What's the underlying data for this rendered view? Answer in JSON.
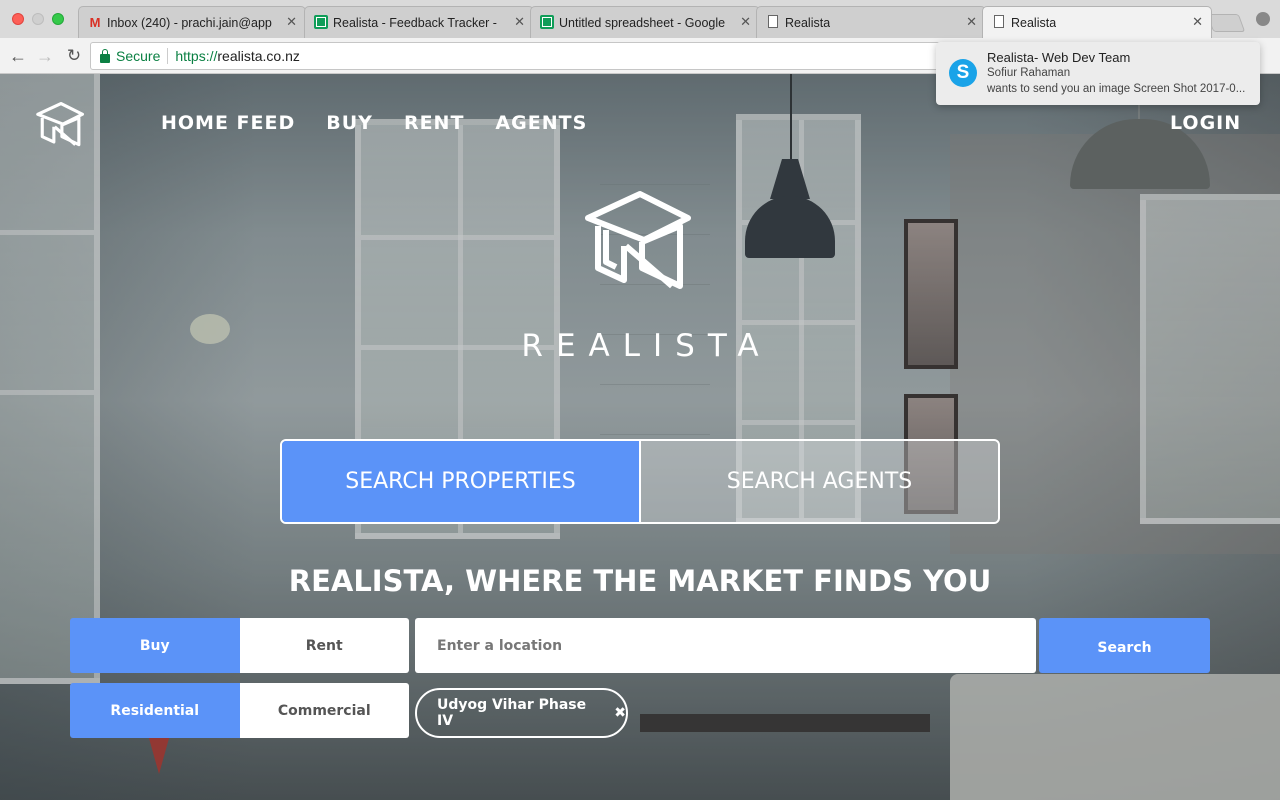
{
  "browser": {
    "tabs": [
      {
        "title": "Inbox (240) - prachi.jain@app",
        "icon": "gmail-icon",
        "active": false
      },
      {
        "title": "Realista - Feedback Tracker -",
        "icon": "sheets-icon",
        "active": false
      },
      {
        "title": "Untitled spreadsheet - Google",
        "icon": "sheets-icon",
        "active": false
      },
      {
        "title": "Realista",
        "icon": "document-icon",
        "active": false
      },
      {
        "title": "Realista",
        "icon": "document-icon",
        "active": true
      }
    ],
    "close_glyph": "✕",
    "secure_label": "Secure",
    "url_scheme": "https://",
    "url_host": "realista.co.nz"
  },
  "notification": {
    "app_icon": "skype-icon",
    "title": "Realista- Web Dev Team",
    "sender": "Sofiur Rahaman",
    "message": "wants to send you an image Screen Shot 2017-0..."
  },
  "site": {
    "nav": {
      "home_feed": "HOME FEED",
      "buy": "BUY",
      "rent": "RENT",
      "agents": "AGENTS",
      "login": "LOGIN"
    },
    "brand": "REALISTA",
    "search_tabs": {
      "properties": "SEARCH PROPERTIES",
      "agents": "SEARCH AGENTS",
      "active": "properties"
    },
    "tagline": "REALISTA, WHERE THE MARKET FINDS YOU",
    "listing_type": {
      "buy": "Buy",
      "rent": "Rent",
      "selected": "Buy"
    },
    "property_type": {
      "residential": "Residential",
      "commercial": "Commercial",
      "selected": "Residential"
    },
    "location_input": {
      "placeholder": "Enter a location",
      "value": ""
    },
    "search_button": "Search",
    "location_chip": {
      "label": "Udyog Vihar Phase IV",
      "remove_glyph": "✖"
    },
    "accent_color": "#5b93f8"
  }
}
